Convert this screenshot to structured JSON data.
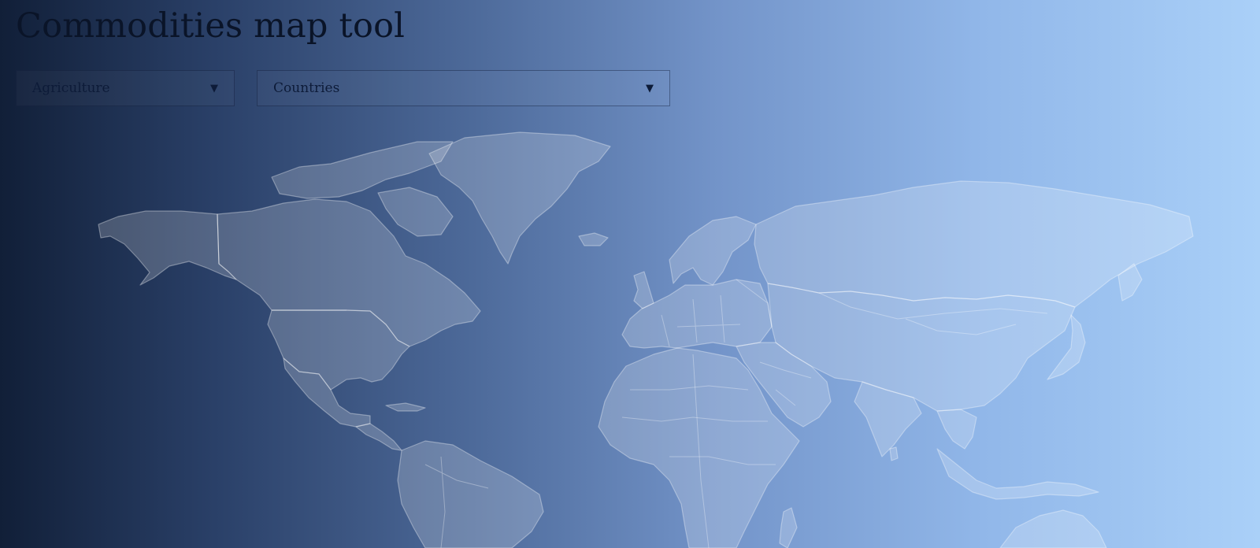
{
  "header": {
    "title": "Commodities map tool"
  },
  "filters": {
    "category": {
      "selected": "Agriculture",
      "caret_icon": "caret-down-icon"
    },
    "region": {
      "selected": "Countries",
      "caret_icon": "caret-down-icon"
    }
  },
  "colors": {
    "gradient_start": "#111f38",
    "gradient_end": "#aad0f8",
    "title_text": "#0a1428",
    "land_fill": "#ffffff"
  }
}
